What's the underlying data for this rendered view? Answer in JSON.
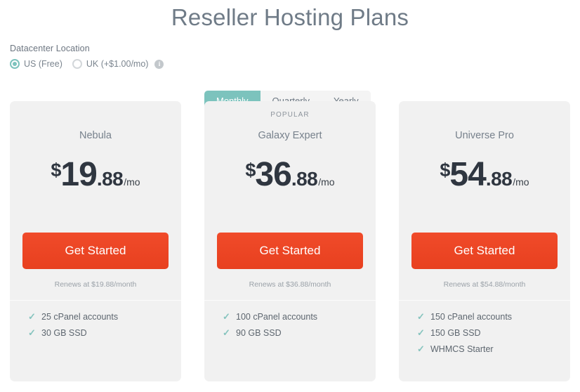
{
  "header": {
    "title": "Reseller Hosting Plans"
  },
  "datacenter": {
    "label": "Datacenter Location",
    "options": [
      {
        "label": "US (Free)",
        "selected": true
      },
      {
        "label": "UK (+$1.00/mo)",
        "selected": false
      }
    ],
    "info_icon": "info-icon",
    "info_glyph": "i"
  },
  "billing_cycle": {
    "options": [
      {
        "label": "Monthly",
        "active": true
      },
      {
        "label": "Quarterly",
        "active": false
      },
      {
        "label": "Yearly",
        "active": false
      }
    ]
  },
  "check_glyph": "✓",
  "colors": {
    "accent_teal": "#7cc3bd",
    "cta_orange": "#ee4323",
    "card_bg": "#f1f1f1",
    "title_gray": "#6f7b87",
    "price_dark": "#2f3640"
  },
  "plans": [
    {
      "badge": "",
      "name": "Nebula",
      "currency": "$",
      "price_whole": "19",
      "price_cents": ".88",
      "price_period": "/mo",
      "cta_label": "Get Started",
      "renew_text": "Renews at $19.88/month",
      "features": [
        "25 cPanel accounts",
        "30 GB SSD"
      ]
    },
    {
      "badge": "POPULAR",
      "name": "Galaxy Expert",
      "currency": "$",
      "price_whole": "36",
      "price_cents": ".88",
      "price_period": "/mo",
      "cta_label": "Get Started",
      "renew_text": "Renews at $36.88/month",
      "features": [
        "100 cPanel accounts",
        "90 GB SSD"
      ]
    },
    {
      "badge": "",
      "name": "Universe Pro",
      "currency": "$",
      "price_whole": "54",
      "price_cents": ".88",
      "price_period": "/mo",
      "cta_label": "Get Started",
      "renew_text": "Renews at $54.88/month",
      "features": [
        "150 cPanel accounts",
        "150 GB SSD",
        "WHMCS Starter"
      ]
    }
  ]
}
